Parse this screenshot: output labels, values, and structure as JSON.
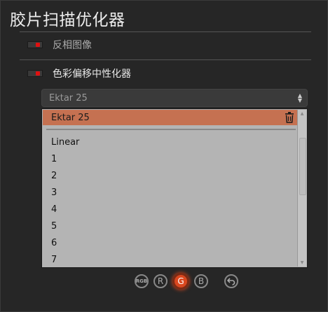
{
  "title": "胶片扫描优化器",
  "options": [
    {
      "label": "反相图像",
      "enabled": true
    },
    {
      "label": "色彩偏移中性化器",
      "enabled": true
    }
  ],
  "preset_select": {
    "value": "Ektar 25"
  },
  "dropdown": {
    "selected": "Ektar 25",
    "items": [
      "Linear",
      "1",
      "2",
      "3",
      "4",
      "5",
      "6",
      "7"
    ]
  },
  "channels": {
    "rgb": "RGB",
    "r": "R",
    "g": "G",
    "b": "B",
    "active": "G"
  },
  "colors": {
    "accent": "#d9471f",
    "selected_row": "#c57151",
    "toggle_on": "#e01010"
  }
}
